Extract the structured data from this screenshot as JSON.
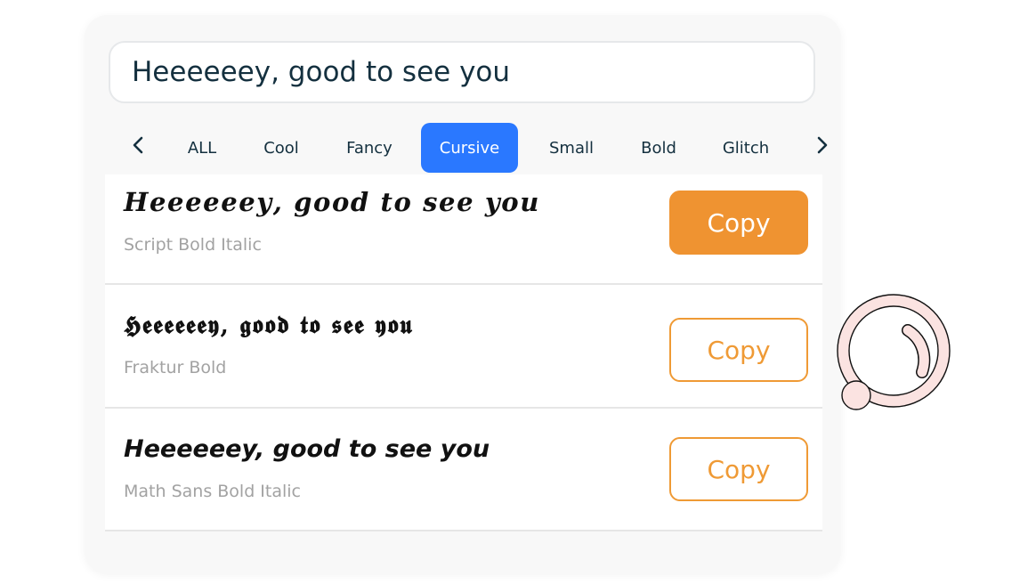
{
  "search": {
    "value": "Heeeeeey, good to see you"
  },
  "tabs": [
    {
      "label": "ALL",
      "active": false
    },
    {
      "label": "Cool",
      "active": false
    },
    {
      "label": "Fancy",
      "active": false
    },
    {
      "label": "Cursive",
      "active": true
    },
    {
      "label": "Small",
      "active": false
    },
    {
      "label": "Bold",
      "active": false
    },
    {
      "label": "Glitch",
      "active": false
    }
  ],
  "results": [
    {
      "text": "𝑯𝒆𝒆𝒆𝒆𝒆𝒆𝒚, 𝒈𝒐𝒐𝒅 𝒕𝒐 𝒔𝒆𝒆 𝒚𝒐𝒖",
      "style_name": "Script Bold Italic",
      "copy_label": "Copy"
    },
    {
      "text": "𝕳𝖊𝖊𝖊𝖊𝖊𝖊𝖞, 𝖌𝖔𝖔𝖉 𝖙𝖔 𝖘𝖊𝖊 𝖞𝖔𝖚",
      "style_name": "Fraktur Bold",
      "copy_label": "Copy"
    },
    {
      "text": "Heeeeeey, good to see you",
      "style_name": "Math Sans Bold Italic",
      "copy_label": "Copy"
    }
  ],
  "colors": {
    "accent_blue": "#2a78ff",
    "copy_orange": "#ef9331",
    "text_dark": "#14303f",
    "label_gray": "#a2a2a2"
  },
  "icons": {
    "prev": "chevron-left-icon",
    "next": "chevron-right-icon",
    "decoration": "pointer-cursor-icon"
  }
}
